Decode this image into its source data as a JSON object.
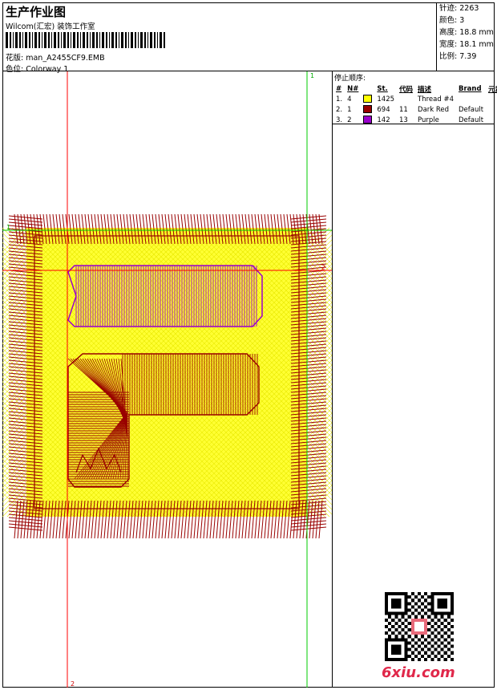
{
  "header": {
    "title": "生产作业图",
    "company": "Wilcom(汇宏) 装饰工作室",
    "design_label": "花版:",
    "design_value": "man_A2455CF9.EMB",
    "colorway_label": "色位:",
    "colorway_value": "Colorway 1"
  },
  "stats": [
    {
      "label": "针迹:",
      "value": "2263"
    },
    {
      "label": "颜色:",
      "value": "3"
    },
    {
      "label": "高度:",
      "value": "18.8 mm"
    },
    {
      "label": "宽度:",
      "value": "18.1 mm"
    },
    {
      "label": "比例:",
      "value": "7.39"
    }
  ],
  "threads": {
    "caption": "停止顺序:",
    "headers": [
      "#",
      "N#",
      "",
      "St.",
      "代码",
      "描述",
      "Brand",
      "元素"
    ],
    "rows": [
      {
        "idx": "1.",
        "n": "4",
        "color": "#ffff00",
        "st": "1425",
        "code": "",
        "desc": "Thread #4",
        "brand": ""
      },
      {
        "idx": "2.",
        "n": "1",
        "color": "#990000",
        "st": "694",
        "code": "11",
        "desc": "Dark Red",
        "brand": "Default"
      },
      {
        "idx": "3.",
        "n": "2",
        "color": "#9900cc",
        "st": "142",
        "code": "13",
        "desc": "Purple",
        "brand": "Default"
      }
    ]
  },
  "markers": {
    "top": "1",
    "bottom": "2",
    "left": "1",
    "right": "2"
  },
  "footer": {
    "logo": "6xiu.com"
  }
}
